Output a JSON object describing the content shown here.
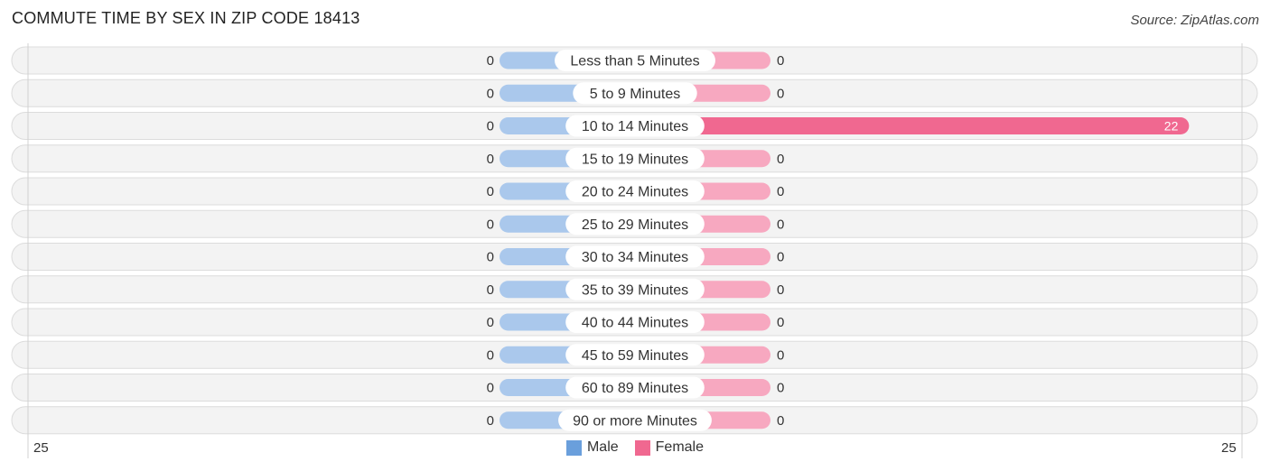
{
  "chart_data": {
    "type": "bar",
    "orientation": "horizontal-diverging",
    "title": "COMMUTE TIME BY SEX IN ZIP CODE 18413",
    "source": "Source: ZipAtlas.com",
    "categories": [
      "Less than 5 Minutes",
      "5 to 9 Minutes",
      "10 to 14 Minutes",
      "15 to 19 Minutes",
      "20 to 24 Minutes",
      "25 to 29 Minutes",
      "30 to 34 Minutes",
      "35 to 39 Minutes",
      "40 to 44 Minutes",
      "45 to 59 Minutes",
      "60 to 89 Minutes",
      "90 or more Minutes"
    ],
    "series": [
      {
        "name": "Male",
        "color": "#6a9fdc",
        "light_color": "#aac8ec",
        "values": [
          0,
          0,
          0,
          0,
          0,
          0,
          0,
          0,
          0,
          0,
          0,
          0
        ]
      },
      {
        "name": "Female",
        "color": "#f06890",
        "light_color": "#f7a8c0",
        "values": [
          0,
          0,
          22,
          0,
          0,
          0,
          0,
          0,
          0,
          0,
          0,
          0
        ]
      }
    ],
    "axis": {
      "left_max": 25,
      "right_max": 25,
      "left_label": "25",
      "right_label": "25"
    },
    "legend": {
      "placement": "bottom-center",
      "items": [
        "Male",
        "Female"
      ]
    }
  }
}
